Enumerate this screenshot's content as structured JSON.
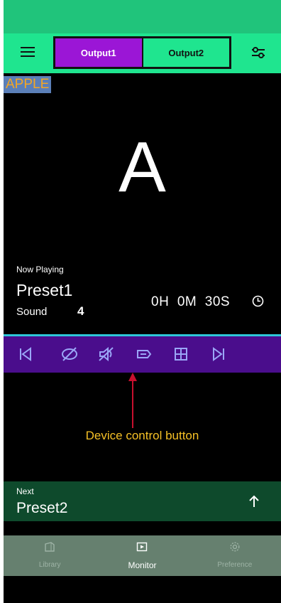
{
  "app_bar": {
    "tabs": [
      {
        "label": "Output1",
        "active": true
      },
      {
        "label": "Output2",
        "active": false
      }
    ],
    "menu_icon": "hamburger-menu-icon",
    "settings_icon": "tune-sliders-icon"
  },
  "display": {
    "tag": "APPLE",
    "big_text": "A"
  },
  "now_playing": {
    "title": "Now Playing",
    "preset": "Preset1",
    "sound_label": "Sound",
    "sound_value": "4",
    "timer": "0H  0M  30S",
    "clock_icon": "clock-icon"
  },
  "controls": [
    {
      "name": "skip-previous-icon"
    },
    {
      "name": "visibility-off-icon"
    },
    {
      "name": "mute-icon"
    },
    {
      "name": "label-icon"
    },
    {
      "name": "grid-icon"
    },
    {
      "name": "skip-next-icon"
    }
  ],
  "annotation": {
    "text": "Device control button",
    "color": "#f5c026",
    "arrow_color": "#c8102e"
  },
  "next": {
    "title": "Next",
    "preset": "Preset2",
    "icon": "arrow-up-icon"
  },
  "bottom_nav": [
    {
      "label": "Library",
      "icon": "library-icon",
      "active": false
    },
    {
      "label": "Monitor",
      "icon": "monitor-icon",
      "active": true
    },
    {
      "label": "Preference",
      "icon": "settings-gear-icon",
      "active": false
    }
  ],
  "colors": {
    "app_bar": "#1fe58f",
    "status_bar": "#20c47b",
    "active_tab": "#9b16d6",
    "control_bar": "#4a0d8c",
    "next_bar": "#0e4a2c",
    "bottom_nav": "#66806f"
  }
}
